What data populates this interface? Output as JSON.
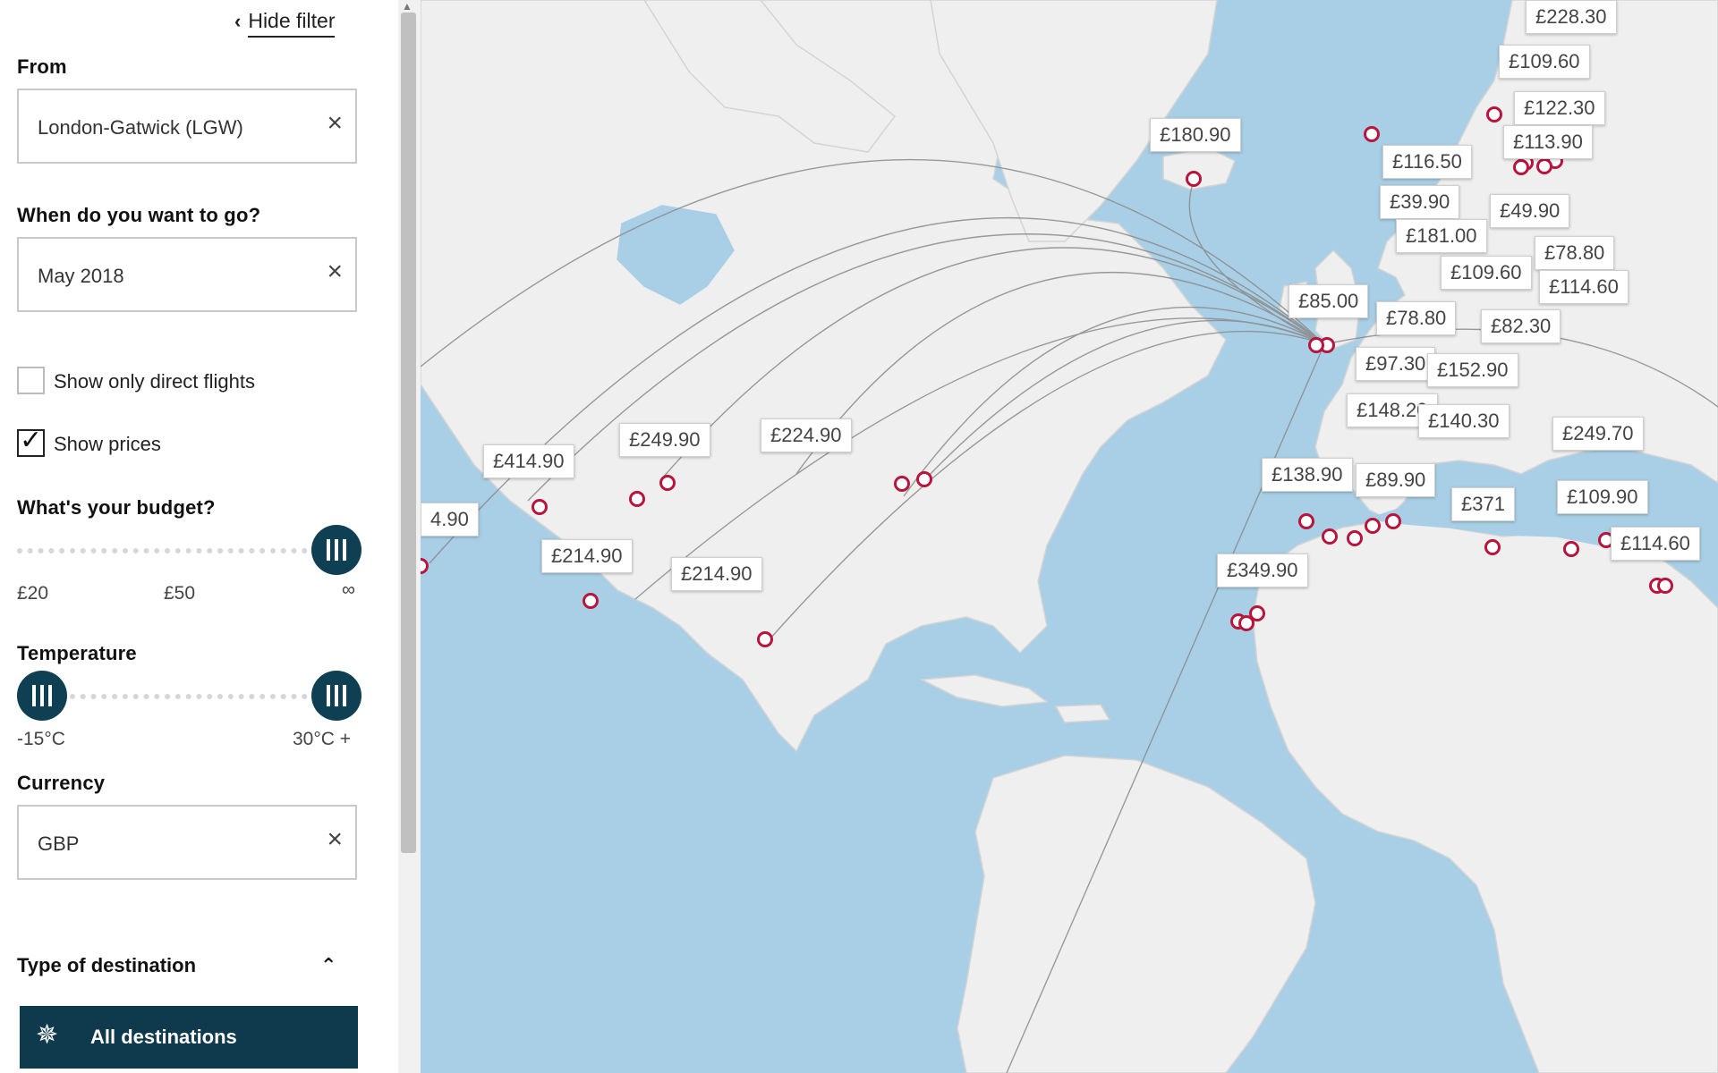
{
  "filter": {
    "hide_filter": "Hide filter",
    "from_label": "From",
    "from_value": "London-Gatwick (LGW)",
    "when_label": "When do you want to go?",
    "when_value": "May 2018",
    "direct_label": "Show only direct flights",
    "direct_checked": false,
    "prices_label": "Show prices",
    "prices_checked": true,
    "budget_label": "What's your budget?",
    "budget_ticks": [
      "£20",
      "£50",
      "∞"
    ],
    "temp_label": "Temperature",
    "temp_min": "-15°C",
    "temp_max": "30°C +",
    "currency_label": "Currency",
    "currency_value": "GBP",
    "type_label": "Type of destination",
    "all_destinations": "All destinations",
    "clear_symbol": "×",
    "icons": [
      "chevron-left-icon",
      "clear-icon",
      "checkmark-icon",
      "slider-grip-icon",
      "chevron-up-icon",
      "destinations-icon"
    ]
  },
  "map": {
    "colors": {
      "water": "#a9cfe6",
      "land": "#efefef",
      "pin": "#b8143c",
      "route": "#8a8a8a"
    },
    "prices": [
      {
        "label": "£228.30"
      },
      {
        "label": "£109.60"
      },
      {
        "label": "£122.30"
      },
      {
        "label": "£113.90"
      },
      {
        "label": "£116.50"
      },
      {
        "label": "£180.90"
      },
      {
        "label": "£39.90"
      },
      {
        "label": "£49.90"
      },
      {
        "label": "£181.00"
      },
      {
        "label": "£78.80"
      },
      {
        "label": "£109.60"
      },
      {
        "label": "£114.60"
      },
      {
        "label": "£85.00"
      },
      {
        "label": "£78.80"
      },
      {
        "label": "£82.30"
      },
      {
        "label": "£97.30"
      },
      {
        "label": "£152.90"
      },
      {
        "label": "£148.20"
      },
      {
        "label": "£140.30"
      },
      {
        "label": "£249.70"
      },
      {
        "label": "£138.90"
      },
      {
        "label": "£89.90"
      },
      {
        "label": "£371"
      },
      {
        "label": "£109.90"
      },
      {
        "label": "£114.60"
      },
      {
        "label": "£349.90"
      },
      {
        "label": "£249.90"
      },
      {
        "label": "£224.90"
      },
      {
        "label": "£414.90"
      },
      {
        "label": "£214.90"
      },
      {
        "label": "£214.90"
      },
      {
        "label": "4.90"
      }
    ]
  }
}
